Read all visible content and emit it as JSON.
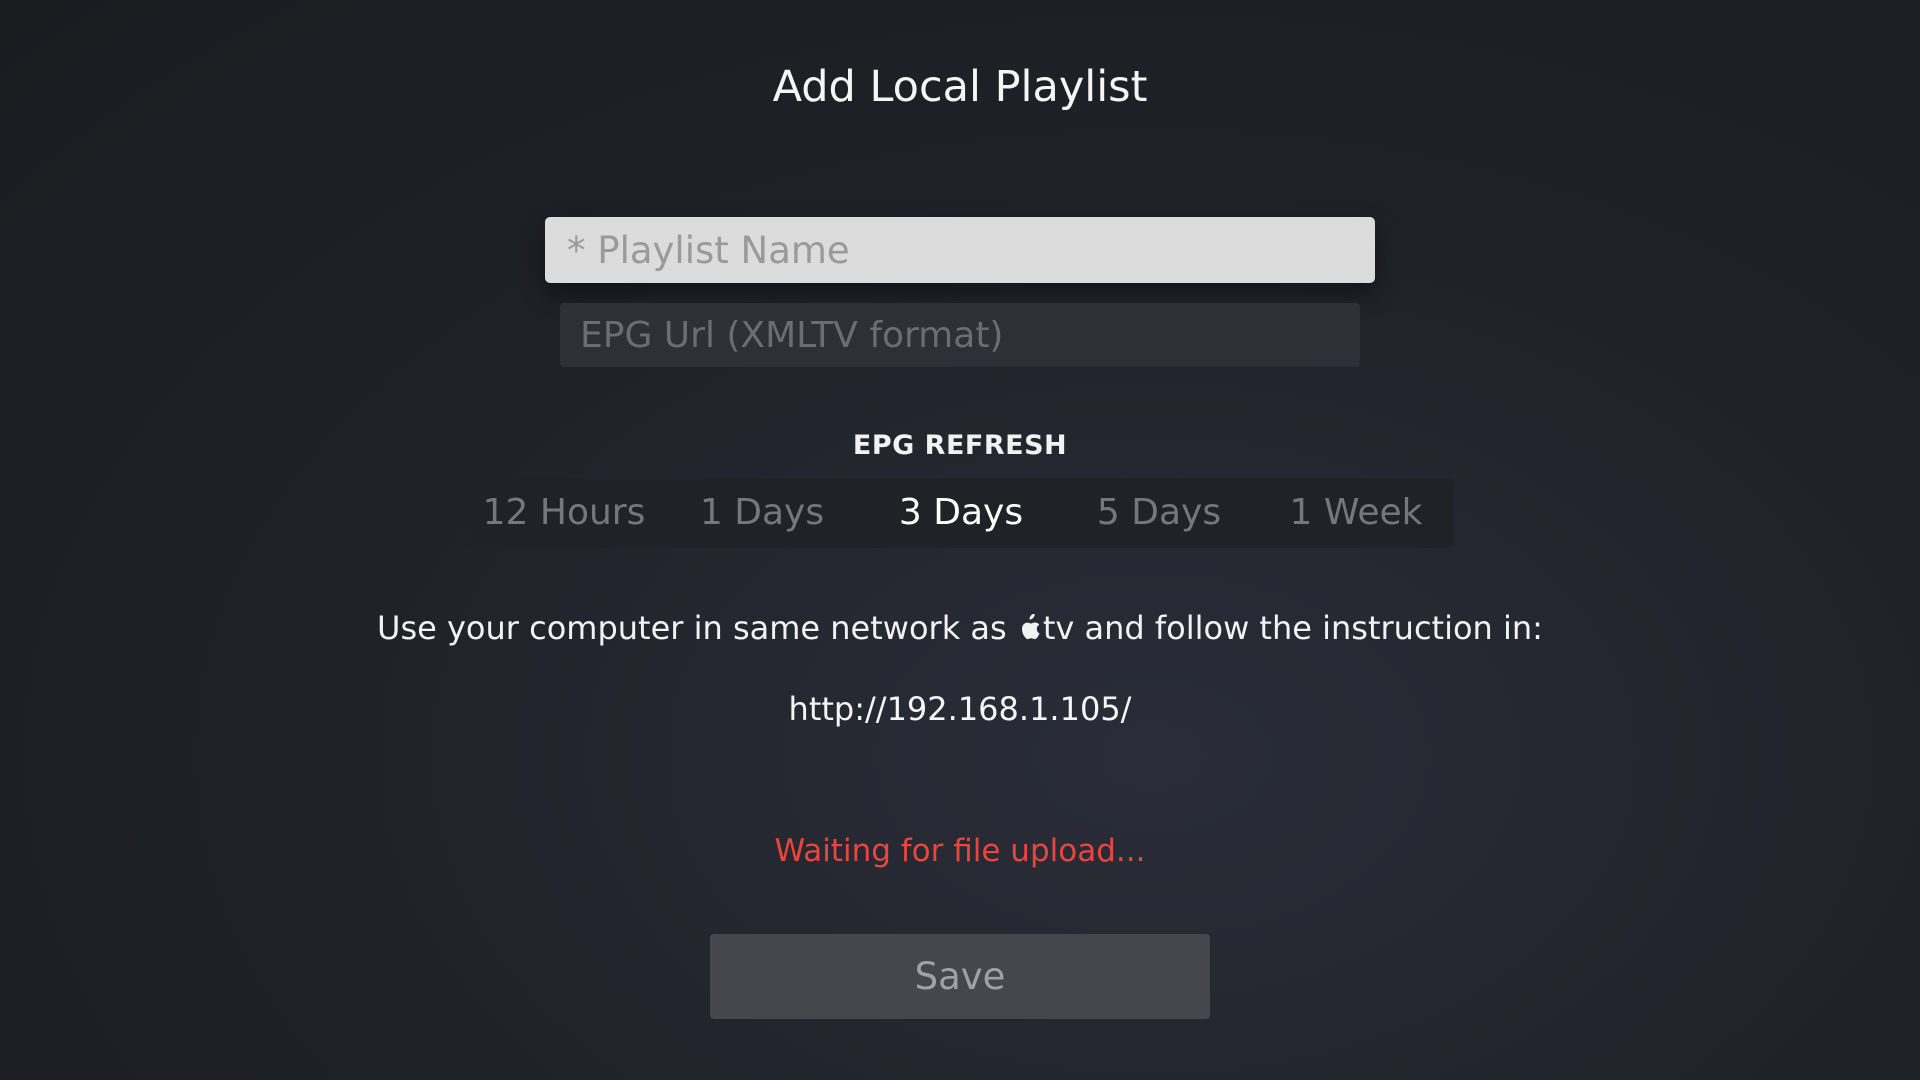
{
  "title": "Add Local Playlist",
  "fields": {
    "playlist_name_placeholder": "* Playlist Name",
    "playlist_name_value": "",
    "epg_url_placeholder": "EPG Url (XMLTV format)",
    "epg_url_value": ""
  },
  "epg_refresh": {
    "label": "EPG REFRESH",
    "options": [
      "12 Hours",
      "1 Days",
      "3 Days",
      "5 Days",
      "1 Week"
    ],
    "selected": "3 Days"
  },
  "instruction": {
    "before_icon": "Use your computer in same network as ",
    "icon": "apple-logo-icon",
    "after_icon": "tv and follow the instruction in:",
    "url": "http://192.168.1.105/"
  },
  "status": {
    "text": "Waiting for file upload...",
    "color": "#e8453c"
  },
  "save_button": {
    "label": "Save"
  }
}
